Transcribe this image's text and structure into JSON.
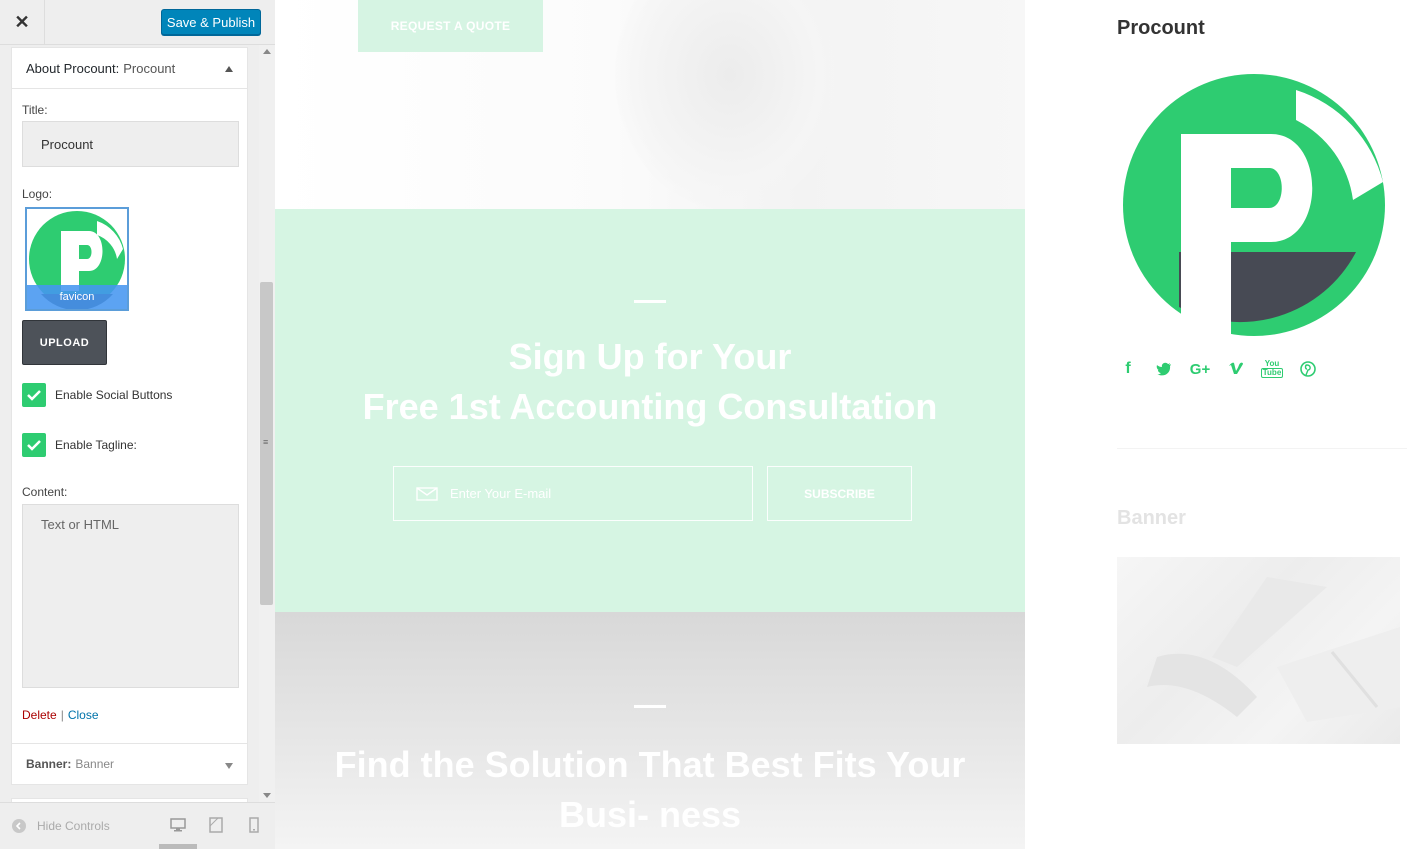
{
  "customizer": {
    "close_label": "✕",
    "save_label": "Save & Publish",
    "widget": {
      "title": "About Procount:",
      "subtitle": "Procount",
      "title_label": "Title:",
      "title_value": "Procount",
      "logo_label": "Logo:",
      "logo_filename": "favicon",
      "upload_label": "UPLOAD",
      "social_label": "Enable Social Buttons",
      "social_checked": true,
      "tagline_label": "Enable Tagline:",
      "tagline_checked": true,
      "content_label": "Content:",
      "content_placeholder": "Text or HTML",
      "delete_label": "Delete",
      "separator": "|",
      "close_link_label": "Close"
    },
    "widget2": {
      "title": "Banner:",
      "subtitle": "Banner"
    },
    "footer": {
      "hide_controls_label": "Hide Controls"
    }
  },
  "preview": {
    "quote_button": "REQUEST A QUOTE",
    "signup_heading_line1": "Sign Up for Your",
    "signup_heading_line2": "Free 1st Accounting Consultation",
    "email_placeholder": "Enter Your E-mail",
    "subscribe_label": "SUBSCRIBE",
    "solution_heading": "Find the Solution That Best Fits Your Busi- ness"
  },
  "right_sidebar": {
    "title": "Procount",
    "social_icons": [
      "facebook-icon",
      "twitter-icon",
      "google-plus-icon",
      "vimeo-icon",
      "youtube-icon",
      "pinterest-icon"
    ],
    "banner_title": "Banner"
  },
  "colors": {
    "brand_green": "#2ecc71",
    "logo_dark": "#474a54",
    "primary_blue": "#0085ba",
    "signup_bg": "#d6f5e3"
  }
}
